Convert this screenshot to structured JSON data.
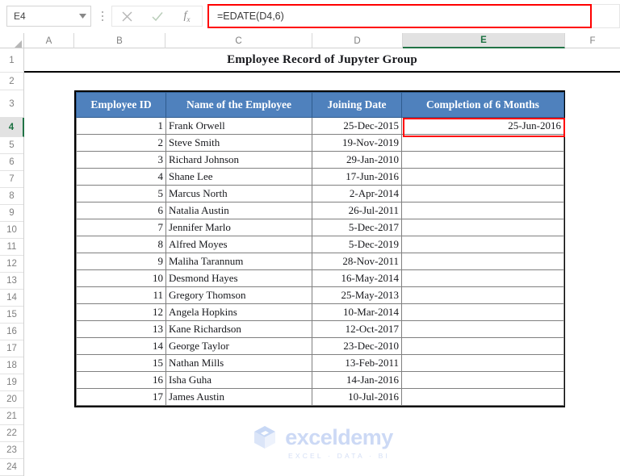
{
  "app": {
    "name_box": {
      "value": "E4",
      "dropdown_icon": "chevron-down-icon"
    },
    "formula_bar": {
      "cancel_icon": "close-icon",
      "confirm_icon": "check-icon",
      "function_icon": "fx-icon",
      "value": "=EDATE(D4,6)",
      "placeholder": ""
    },
    "selected_cell": "E4",
    "selected_column": "E"
  },
  "grid": {
    "columns": [
      "A",
      "B",
      "C",
      "D",
      "E",
      "F"
    ],
    "rows": [
      "1",
      "2",
      "3",
      "4",
      "5",
      "6",
      "7",
      "8",
      "9",
      "10",
      "11",
      "12",
      "13",
      "14",
      "15",
      "16",
      "17",
      "18",
      "19",
      "20",
      "21",
      "22",
      "23",
      "24"
    ]
  },
  "sheet": {
    "title": "Employee Record of Jupyter Group",
    "headers": [
      "Employee ID",
      "Name of the Employee",
      "Joining Date",
      "Completion of 6 Months"
    ],
    "rows": [
      {
        "id": "1",
        "name": "Frank Orwell",
        "joining": "25-Dec-2015",
        "completion": "25-Jun-2016"
      },
      {
        "id": "2",
        "name": "Steve Smith",
        "joining": "19-Nov-2019",
        "completion": ""
      },
      {
        "id": "3",
        "name": "Richard Johnson",
        "joining": "29-Jan-2010",
        "completion": ""
      },
      {
        "id": "4",
        "name": "Shane Lee",
        "joining": "17-Jun-2016",
        "completion": ""
      },
      {
        "id": "5",
        "name": "Marcus North",
        "joining": "2-Apr-2014",
        "completion": ""
      },
      {
        "id": "6",
        "name": "Natalia Austin",
        "joining": "26-Jul-2011",
        "completion": ""
      },
      {
        "id": "7",
        "name": "Jennifer Marlo",
        "joining": "5-Dec-2017",
        "completion": ""
      },
      {
        "id": "8",
        "name": "Alfred Moyes",
        "joining": "5-Dec-2019",
        "completion": ""
      },
      {
        "id": "9",
        "name": "Maliha Tarannum",
        "joining": "28-Nov-2011",
        "completion": ""
      },
      {
        "id": "10",
        "name": "Desmond Hayes",
        "joining": "16-May-2014",
        "completion": ""
      },
      {
        "id": "11",
        "name": "Gregory Thomson",
        "joining": "25-May-2013",
        "completion": ""
      },
      {
        "id": "12",
        "name": "Angela Hopkins",
        "joining": "10-Mar-2014",
        "completion": ""
      },
      {
        "id": "13",
        "name": "Kane Richardson",
        "joining": "12-Oct-2017",
        "completion": ""
      },
      {
        "id": "14",
        "name": "George Taylor",
        "joining": "23-Dec-2010",
        "completion": ""
      },
      {
        "id": "15",
        "name": "Nathan Mills",
        "joining": "13-Feb-2011",
        "completion": ""
      },
      {
        "id": "16",
        "name": "Isha Guha",
        "joining": "14-Jan-2016",
        "completion": ""
      },
      {
        "id": "17",
        "name": "James Austin",
        "joining": "10-Jul-2016",
        "completion": ""
      }
    ]
  },
  "watermark": {
    "brand": "exceldemy",
    "tagline": "EXCEL  ·  DATA  ·  BI",
    "logo_icon": "cube-logo-icon"
  },
  "colors": {
    "header_fill": "#4f81bd",
    "header_text": "#ffffff",
    "highlight_border": "#ff0000",
    "selection_green": "#217346",
    "watermark": "#ccd9f5"
  }
}
